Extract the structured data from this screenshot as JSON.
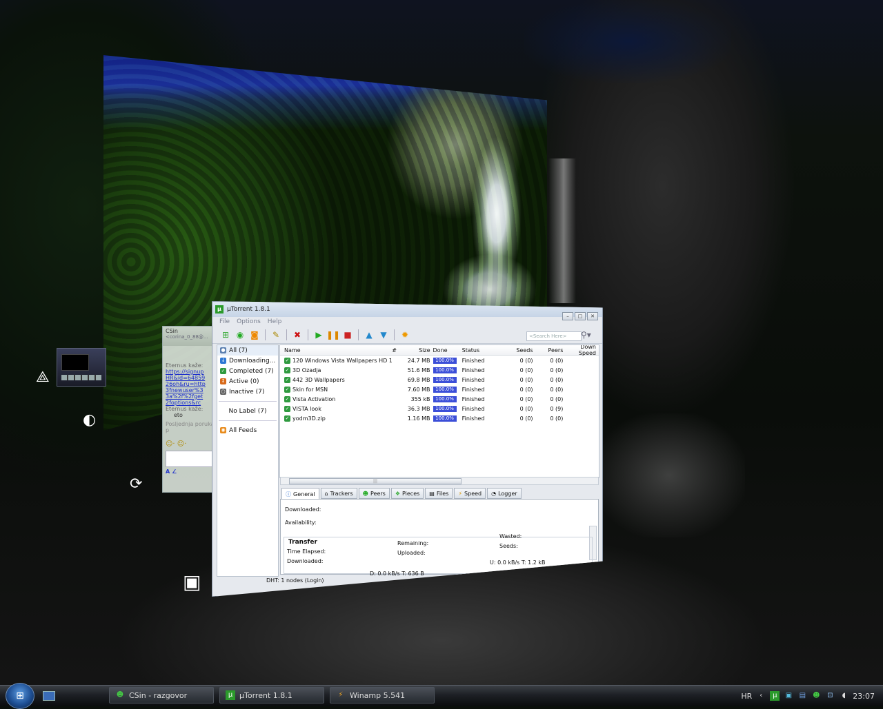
{
  "chat": {
    "title": "CSin",
    "subtitle": "<corina_0_88@...",
    "sender1": "Eternus kaže:",
    "links": [
      "https://signup",
      "HR&id=64859",
      "26oh&ru=http",
      "3fnewuser%3",
      "3a%2f%2fget",
      "2foptions&rc"
    ],
    "sender2": "Eternus kaže:",
    "msg2": "eto",
    "last_msg": "Posljednja poruka p"
  },
  "utorrent": {
    "title": "µTorrent 1.8.1",
    "menu": [
      "File",
      "Options",
      "Help"
    ],
    "search_placeholder": "<Search Here>",
    "sidebar": [
      {
        "label": "All (7)",
        "icon": "all-icon"
      },
      {
        "label": "Downloading...",
        "icon": "download-icon"
      },
      {
        "label": "Completed (7)",
        "icon": "completed-icon"
      },
      {
        "label": "Active (0)",
        "icon": "active-icon"
      },
      {
        "label": "Inactive (7)",
        "icon": "inactive-icon"
      }
    ],
    "no_label": "No Label (7)",
    "all_feeds": "All Feeds",
    "columns": {
      "name": "Name",
      "num": "#",
      "size": "Size",
      "done": "Done",
      "status": "Status",
      "seeds": "Seeds",
      "peers": "Peers",
      "down": "Down Speed"
    },
    "torrents": [
      {
        "name": "120 Windows Vista Wallpapers HD 1...",
        "size": "24.7 MB",
        "done": "100.0%",
        "status": "Finished",
        "seeds": "0 (0)",
        "peers": "0 (0)"
      },
      {
        "name": "3D Ozadja",
        "size": "51.6 MB",
        "done": "100.0%",
        "status": "Finished",
        "seeds": "0 (0)",
        "peers": "0 (0)"
      },
      {
        "name": "442 3D Wallpapers",
        "size": "69.8 MB",
        "done": "100.0%",
        "status": "Finished",
        "seeds": "0 (0)",
        "peers": "0 (0)"
      },
      {
        "name": "Skin for MSN",
        "size": "7.60 MB",
        "done": "100.0%",
        "status": "Finished",
        "seeds": "0 (0)",
        "peers": "0 (0)"
      },
      {
        "name": "Vista Activation",
        "size": "355 kB",
        "done": "100.0%",
        "status": "Finished",
        "seeds": "0 (0)",
        "peers": "0 (0)"
      },
      {
        "name": "VISTA look",
        "size": "36.3 MB",
        "done": "100.0%",
        "status": "Finished",
        "seeds": "0 (0)",
        "peers": "0 (9)"
      },
      {
        "name": "yodm3D.zip",
        "size": "1.16 MB",
        "done": "100.0%",
        "status": "Finished",
        "seeds": "0 (0)",
        "peers": "0 (0)"
      }
    ],
    "tabs": [
      "General",
      "Trackers",
      "Peers",
      "Pieces",
      "Files",
      "Speed",
      "Logger"
    ],
    "general": {
      "downloaded": "Downloaded:",
      "availability": "Availability:",
      "transfer": "Transfer",
      "time_elapsed": "Time Elapsed:",
      "downloaded2": "Downloaded:",
      "remaining": "Remaining:",
      "uploaded": "Uploaded:",
      "wasted": "Wasted:",
      "seeds": "Seeds:"
    },
    "status": {
      "dht": "DHT: 1 nodes (Login)",
      "down": "D: 0.0 kB/s T: 636 B",
      "up": "U: 0.0 kB/s T: 1.2 kB"
    }
  },
  "taskbar": {
    "tasks": [
      {
        "label": "CSin - razgovor",
        "icon": "msn-icon"
      },
      {
        "label": "µTorrent 1.8.1",
        "icon": "utorrent-icon"
      },
      {
        "label": "Winamp 5.541",
        "icon": "winamp-icon"
      }
    ],
    "language": "HR",
    "clock": "23:07"
  }
}
